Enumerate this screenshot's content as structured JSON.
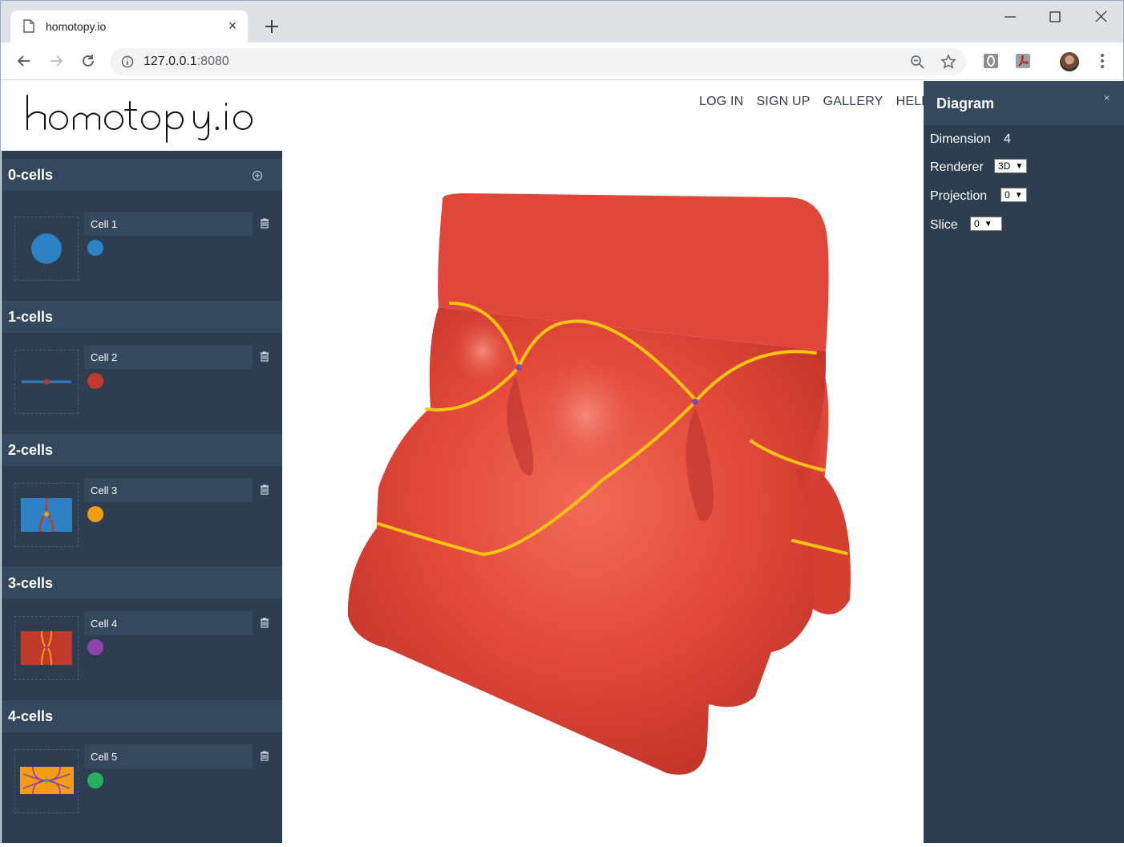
{
  "browser": {
    "tab_title": "homotopy.io",
    "url_host": "127.0.0.1",
    "url_port": ":8080"
  },
  "app": {
    "logo_text": "homotopy.io",
    "nav": [
      "LOG IN",
      "SIGN UP",
      "GALLERY",
      "HELP"
    ]
  },
  "sidebar": {
    "sections": [
      {
        "title": "0-cells",
        "cell": "Cell 1",
        "color": "#2d82c4"
      },
      {
        "title": "1-cells",
        "cell": "Cell 2",
        "color": "#c0392b"
      },
      {
        "title": "2-cells",
        "cell": "Cell 3",
        "color": "#f39c12"
      },
      {
        "title": "3-cells",
        "cell": "Cell 4",
        "color": "#8e44ad"
      },
      {
        "title": "4-cells",
        "cell": "Cell 5",
        "color": "#27ae60"
      }
    ]
  },
  "panel": {
    "title": "Diagram",
    "close": "×",
    "dimension_label": "Dimension",
    "dimension_value": "4",
    "renderer_label": "Renderer",
    "renderer_value": "3D",
    "projection_label": "Projection",
    "projection_value": "0",
    "slice_label": "Slice",
    "slice_value": "0"
  }
}
